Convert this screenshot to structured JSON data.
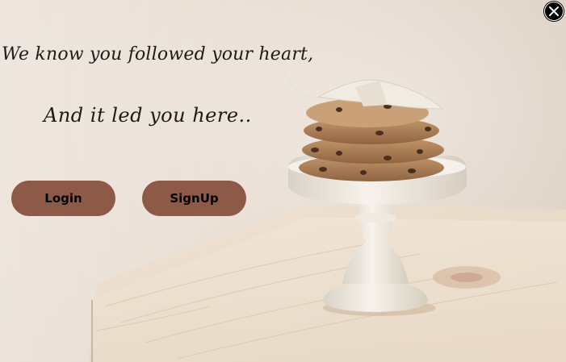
{
  "hero": {
    "line1": "We know you followed your heart,",
    "line2": "And it led you here.."
  },
  "actions": {
    "login_label": "Login",
    "signup_label": "SignUp"
  },
  "close": {
    "icon": "close-icon"
  },
  "colors": {
    "button_bg": "#8e5a48",
    "text": "#1e1a18",
    "close_bg": "#000000"
  }
}
